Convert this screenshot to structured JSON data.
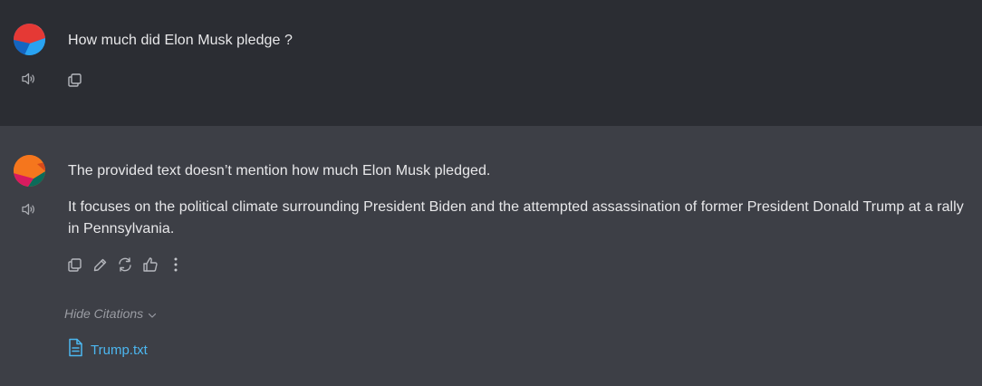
{
  "conversation": {
    "user_message": {
      "text": "How much did Elon Musk pledge ?",
      "icons": [
        "user-avatar",
        "speaker-icon",
        "copy-icon"
      ]
    },
    "assistant_message": {
      "paragraphs": [
        "The provided text doesn’t mention how much Elon Musk pledged.",
        "It focuses on the political climate surrounding President Biden and the attempted assassination of former President Donald Trump at a rally in Pennsylvania."
      ],
      "icons": [
        "assistant-avatar",
        "speaker-icon",
        "copy-icon",
        "pencil-icon",
        "refresh-icon",
        "thumbs-up-icon",
        "more-vertical-icon"
      ],
      "citations_toggle_label": "Hide Citations",
      "citations": [
        {
          "file_name": "Trump.txt",
          "icon": "document-icon"
        }
      ]
    }
  },
  "colors": {
    "user_bg": "#2b2d33",
    "assistant_bg": "#3d3f46",
    "text": "#e8e8ea",
    "muted": "#9a9ca3",
    "link": "#4cb7f0"
  }
}
